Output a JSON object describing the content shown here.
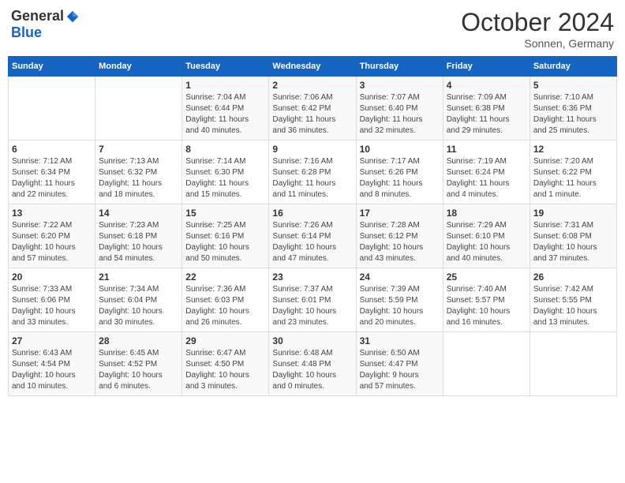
{
  "logo": {
    "general": "General",
    "blue": "Blue"
  },
  "header": {
    "month": "October 2024",
    "location": "Sonnen, Germany"
  },
  "columns": [
    "Sunday",
    "Monday",
    "Tuesday",
    "Wednesday",
    "Thursday",
    "Friday",
    "Saturday"
  ],
  "weeks": [
    [
      {
        "day": "",
        "info": ""
      },
      {
        "day": "",
        "info": ""
      },
      {
        "day": "1",
        "info": "Sunrise: 7:04 AM\nSunset: 6:44 PM\nDaylight: 11 hours\nand 40 minutes."
      },
      {
        "day": "2",
        "info": "Sunrise: 7:06 AM\nSunset: 6:42 PM\nDaylight: 11 hours\nand 36 minutes."
      },
      {
        "day": "3",
        "info": "Sunrise: 7:07 AM\nSunset: 6:40 PM\nDaylight: 11 hours\nand 32 minutes."
      },
      {
        "day": "4",
        "info": "Sunrise: 7:09 AM\nSunset: 6:38 PM\nDaylight: 11 hours\nand 29 minutes."
      },
      {
        "day": "5",
        "info": "Sunrise: 7:10 AM\nSunset: 6:36 PM\nDaylight: 11 hours\nand 25 minutes."
      }
    ],
    [
      {
        "day": "6",
        "info": "Sunrise: 7:12 AM\nSunset: 6:34 PM\nDaylight: 11 hours\nand 22 minutes."
      },
      {
        "day": "7",
        "info": "Sunrise: 7:13 AM\nSunset: 6:32 PM\nDaylight: 11 hours\nand 18 minutes."
      },
      {
        "day": "8",
        "info": "Sunrise: 7:14 AM\nSunset: 6:30 PM\nDaylight: 11 hours\nand 15 minutes."
      },
      {
        "day": "9",
        "info": "Sunrise: 7:16 AM\nSunset: 6:28 PM\nDaylight: 11 hours\nand 11 minutes."
      },
      {
        "day": "10",
        "info": "Sunrise: 7:17 AM\nSunset: 6:26 PM\nDaylight: 11 hours\nand 8 minutes."
      },
      {
        "day": "11",
        "info": "Sunrise: 7:19 AM\nSunset: 6:24 PM\nDaylight: 11 hours\nand 4 minutes."
      },
      {
        "day": "12",
        "info": "Sunrise: 7:20 AM\nSunset: 6:22 PM\nDaylight: 11 hours\nand 1 minute."
      }
    ],
    [
      {
        "day": "13",
        "info": "Sunrise: 7:22 AM\nSunset: 6:20 PM\nDaylight: 10 hours\nand 57 minutes."
      },
      {
        "day": "14",
        "info": "Sunrise: 7:23 AM\nSunset: 6:18 PM\nDaylight: 10 hours\nand 54 minutes."
      },
      {
        "day": "15",
        "info": "Sunrise: 7:25 AM\nSunset: 6:16 PM\nDaylight: 10 hours\nand 50 minutes."
      },
      {
        "day": "16",
        "info": "Sunrise: 7:26 AM\nSunset: 6:14 PM\nDaylight: 10 hours\nand 47 minutes."
      },
      {
        "day": "17",
        "info": "Sunrise: 7:28 AM\nSunset: 6:12 PM\nDaylight: 10 hours\nand 43 minutes."
      },
      {
        "day": "18",
        "info": "Sunrise: 7:29 AM\nSunset: 6:10 PM\nDaylight: 10 hours\nand 40 minutes."
      },
      {
        "day": "19",
        "info": "Sunrise: 7:31 AM\nSunset: 6:08 PM\nDaylight: 10 hours\nand 37 minutes."
      }
    ],
    [
      {
        "day": "20",
        "info": "Sunrise: 7:33 AM\nSunset: 6:06 PM\nDaylight: 10 hours\nand 33 minutes."
      },
      {
        "day": "21",
        "info": "Sunrise: 7:34 AM\nSunset: 6:04 PM\nDaylight: 10 hours\nand 30 minutes."
      },
      {
        "day": "22",
        "info": "Sunrise: 7:36 AM\nSunset: 6:03 PM\nDaylight: 10 hours\nand 26 minutes."
      },
      {
        "day": "23",
        "info": "Sunrise: 7:37 AM\nSunset: 6:01 PM\nDaylight: 10 hours\nand 23 minutes."
      },
      {
        "day": "24",
        "info": "Sunrise: 7:39 AM\nSunset: 5:59 PM\nDaylight: 10 hours\nand 20 minutes."
      },
      {
        "day": "25",
        "info": "Sunrise: 7:40 AM\nSunset: 5:57 PM\nDaylight: 10 hours\nand 16 minutes."
      },
      {
        "day": "26",
        "info": "Sunrise: 7:42 AM\nSunset: 5:55 PM\nDaylight: 10 hours\nand 13 minutes."
      }
    ],
    [
      {
        "day": "27",
        "info": "Sunrise: 6:43 AM\nSunset: 4:54 PM\nDaylight: 10 hours\nand 10 minutes."
      },
      {
        "day": "28",
        "info": "Sunrise: 6:45 AM\nSunset: 4:52 PM\nDaylight: 10 hours\nand 6 minutes."
      },
      {
        "day": "29",
        "info": "Sunrise: 6:47 AM\nSunset: 4:50 PM\nDaylight: 10 hours\nand 3 minutes."
      },
      {
        "day": "30",
        "info": "Sunrise: 6:48 AM\nSunset: 4:48 PM\nDaylight: 10 hours\nand 0 minutes."
      },
      {
        "day": "31",
        "info": "Sunrise: 6:50 AM\nSunset: 4:47 PM\nDaylight: 9 hours\nand 57 minutes."
      },
      {
        "day": "",
        "info": ""
      },
      {
        "day": "",
        "info": ""
      }
    ]
  ]
}
